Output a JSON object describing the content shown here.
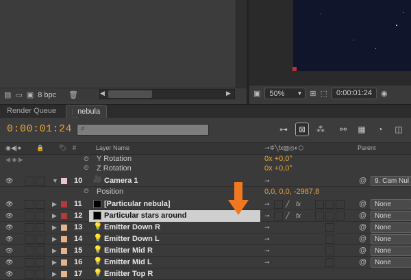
{
  "project_panel": {
    "bpc": "8 bpc"
  },
  "viewer": {
    "zoom": "50%",
    "time": "0:00:01:24"
  },
  "tabs": [
    {
      "label": "Render Queue"
    },
    {
      "label": "nebula",
      "close": "✕"
    }
  ],
  "timeline": {
    "timecode": "0:00:01:24",
    "search_placeholder": ""
  },
  "columns": {
    "number": "#",
    "layer_name": "Layer Name",
    "parent": "Parent"
  },
  "properties": [
    {
      "name": "Y Rotation",
      "value": "0x +0,0°"
    },
    {
      "name": "Z Rotation",
      "value": "0x +0,0°"
    },
    {
      "name": "Position",
      "value": "0,0, 0,0, -2987,8"
    }
  ],
  "layers": [
    {
      "num": "10",
      "name": "Camera 1",
      "type": "camera",
      "label_color": "#e9c6cf",
      "parent": "9. Cam Nul"
    },
    {
      "num": "11",
      "name": "[Particular nebula]",
      "type": "solid",
      "label_color": "#b43a3a",
      "parent": "None"
    },
    {
      "num": "12",
      "name": "Particular stars around",
      "type": "solid",
      "label_color": "#b43a3a",
      "parent": "None",
      "selected": true
    },
    {
      "num": "13",
      "name": "Emitter Down R",
      "type": "light",
      "label_color": "#e6b48c",
      "parent": "None"
    },
    {
      "num": "14",
      "name": "Emitter Down L",
      "type": "light",
      "label_color": "#e6b48c",
      "parent": "None"
    },
    {
      "num": "15",
      "name": "Emitter Mid R",
      "type": "light",
      "label_color": "#e6b48c",
      "parent": "None"
    },
    {
      "num": "16",
      "name": "Emitter Mid L",
      "type": "light",
      "label_color": "#e6b48c",
      "parent": "None"
    },
    {
      "num": "17",
      "name": "Emitter Top R",
      "type": "light",
      "label_color": "#e6b48c",
      "parent": "None"
    }
  ],
  "colors": {
    "timecode": "#e8a53a",
    "arrow": "#f07820",
    "selection": "#cfcfcf"
  }
}
